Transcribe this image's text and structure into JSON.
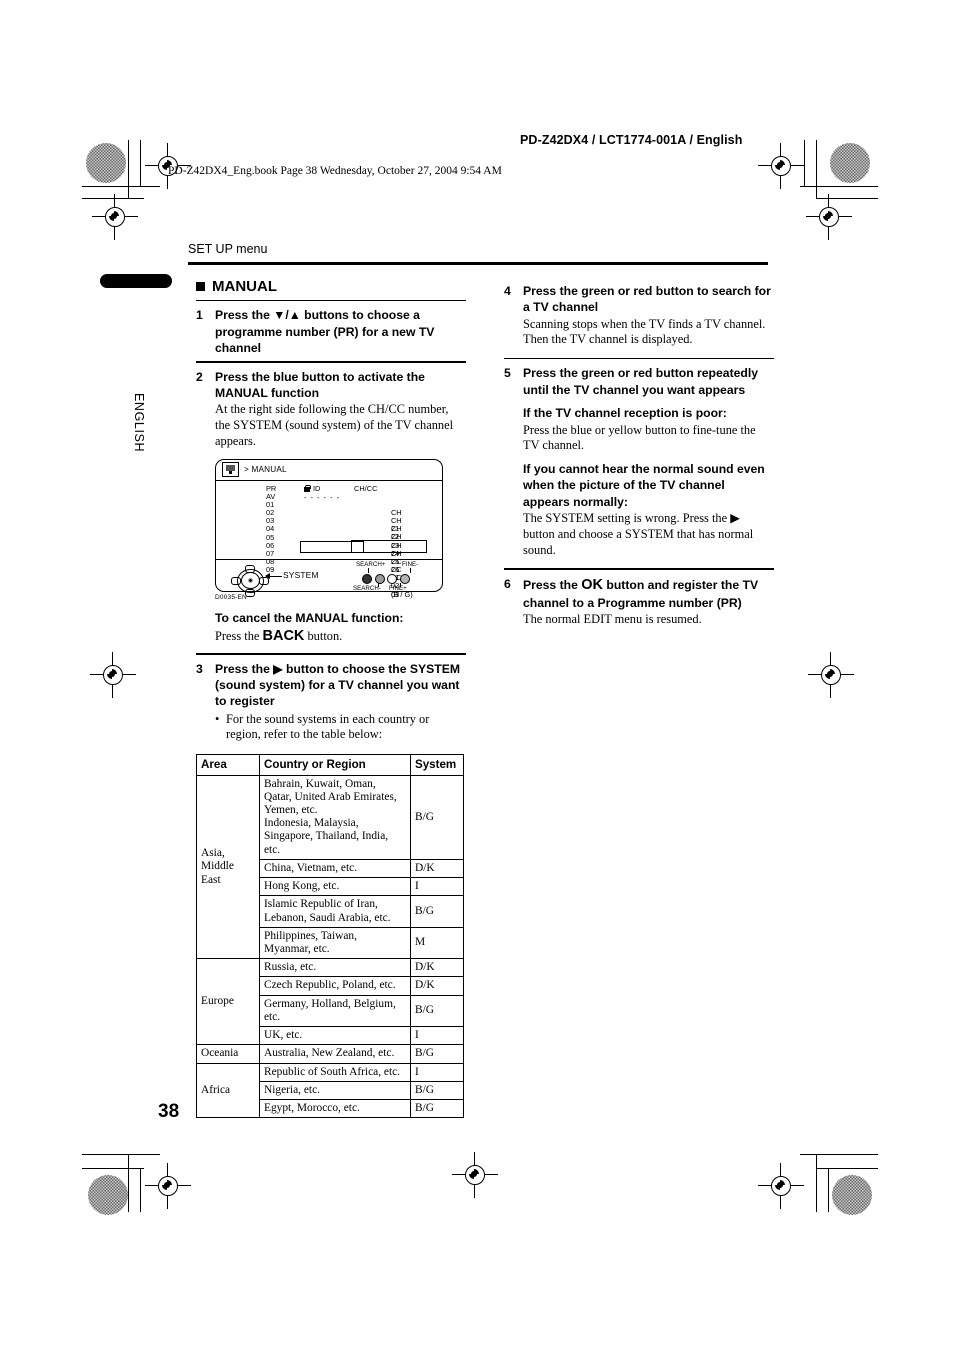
{
  "printheader": {
    "model_code": "PD-Z42DX4 / LCT1774-001A / English",
    "book_line": "PD-Z42DX4_Eng.book  Page 38  Wednesday, October 27, 2004  9:54 AM"
  },
  "page": {
    "section_title": "SET UP menu",
    "side_tab_label": "ENGLISH",
    "page_number": "38"
  },
  "block": {
    "heading": "MANUAL"
  },
  "steps": [
    {
      "num": "1",
      "head_parts": [
        "Press the ",
        "▼/▲",
        " buttons to choose a programme number (PR) for a new TV channel"
      ],
      "head": "Press the ▼/▲ buttons to choose a programme number (PR) for a new TV channel",
      "body": ""
    },
    {
      "num": "2",
      "head": "Press the blue button to activate the MANUAL function",
      "body": "At the right side following the CH/CC number, the SYSTEM (sound system) of the TV channel appears."
    },
    {
      "num": "3",
      "head": "Press the ▶ button to choose the SYSTEM (sound system) for a TV channel you want to register",
      "bullet": "For the sound systems in each country or region, refer to the table below:"
    },
    {
      "num": "4",
      "head": "Press the green or red button to search for a TV channel",
      "body": "Scanning stops when the TV finds a TV channel. Then the TV channel is displayed."
    },
    {
      "num": "5",
      "head": "Press the green or red button repeatedly until the TV channel you want appears"
    },
    {
      "num": "6",
      "head_pre": "Press the ",
      "head_ok": "OK",
      "head_post": " button and register the TV channel to a Programme number (PR)",
      "head": "Press the OK button and register the TV channel to a Programme number (PR)",
      "body": "The normal EDIT menu is resumed."
    }
  ],
  "cancel_note": {
    "head": "To cancel the MANUAL function:",
    "pre": "Press the ",
    "key": "BACK",
    "post": " button."
  },
  "notes": [
    {
      "head": "If the TV channel reception is poor:",
      "body": "Press the blue or yellow button to fine-tune the TV channel."
    },
    {
      "head": "If you cannot hear the normal sound even when the picture of the TV channel appears normally:",
      "body_pre": "The SYSTEM setting is wrong. Press the ",
      "body_arrow": "▶",
      "body_post": " button and choose a SYSTEM that has normal sound.",
      "body": "The SYSTEM setting is wrong. Press the ▶ button and choose a SYSTEM that has normal sound."
    }
  ],
  "figure": {
    "title": "> MANUAL",
    "icon_name": "tv-setup-icon",
    "columns": {
      "pr": "PR",
      "id": "ID",
      "chcc": "CH/CC"
    },
    "pr_rows": [
      "AV",
      "01",
      "02",
      "03",
      "04",
      "05",
      "06",
      "07",
      "08",
      "09"
    ],
    "id_dashes": "- - - - - -",
    "ch_rows": [
      {
        "type": "CH",
        "num": "21"
      },
      {
        "type": "CH",
        "num": "22"
      },
      {
        "type": "CH",
        "num": "23"
      },
      {
        "type": "CH",
        "num": "24"
      },
      {
        "type": "CH",
        "num": "25"
      },
      {
        "type": "CH",
        "num": "26"
      },
      {
        "type": "CC",
        "num": "01",
        "system": "(B / G)"
      },
      {
        "type": "CC",
        "num": "02"
      },
      {
        "type": "CC",
        "num": "03"
      }
    ],
    "system_label": "SYSTEM",
    "button_labels": {
      "search_plus": "SEARCH+",
      "search_minus": "SEARCH-",
      "fine_minus": "FINE-",
      "fine_plus": "FINE+"
    },
    "caption": "D0035-EN"
  },
  "table": {
    "headers": [
      "Area",
      "Country or Region",
      "System"
    ],
    "groups": [
      {
        "area": "Asia, Middle East",
        "rows": [
          {
            "country": "Bahrain, Kuwait, Oman, Qatar, United Arab Emirates, Yemen, etc.\nIndonesia, Malaysia, Singapore, Thailand, India, etc.",
            "system": "B/G"
          },
          {
            "country": "China, Vietnam, etc.",
            "system": "D/K"
          },
          {
            "country": "Hong Kong, etc.",
            "system": "I"
          },
          {
            "country": "Islamic Republic of Iran, Lebanon, Saudi Arabia, etc.",
            "system": "B/G"
          },
          {
            "country": "Philippines, Taiwan, Myanmar, etc.",
            "system": "M"
          }
        ]
      },
      {
        "area": "Europe",
        "rows": [
          {
            "country": "Russia, etc.",
            "system": "D/K"
          },
          {
            "country": "Czech Republic, Poland, etc.",
            "system": "D/K"
          },
          {
            "country": "Germany, Holland, Belgium, etc.",
            "system": "B/G"
          },
          {
            "country": "UK, etc.",
            "system": "I"
          }
        ]
      },
      {
        "area": "Oceania",
        "rows": [
          {
            "country": "Australia, New Zealand, etc.",
            "system": "B/G"
          }
        ]
      },
      {
        "area": "Africa",
        "rows": [
          {
            "country": "Republic of South Africa, etc.",
            "system": "I"
          },
          {
            "country": "Nigeria, etc.",
            "system": "B/G"
          },
          {
            "country": "Egypt, Morocco, etc.",
            "system": "B/G"
          }
        ]
      }
    ]
  }
}
